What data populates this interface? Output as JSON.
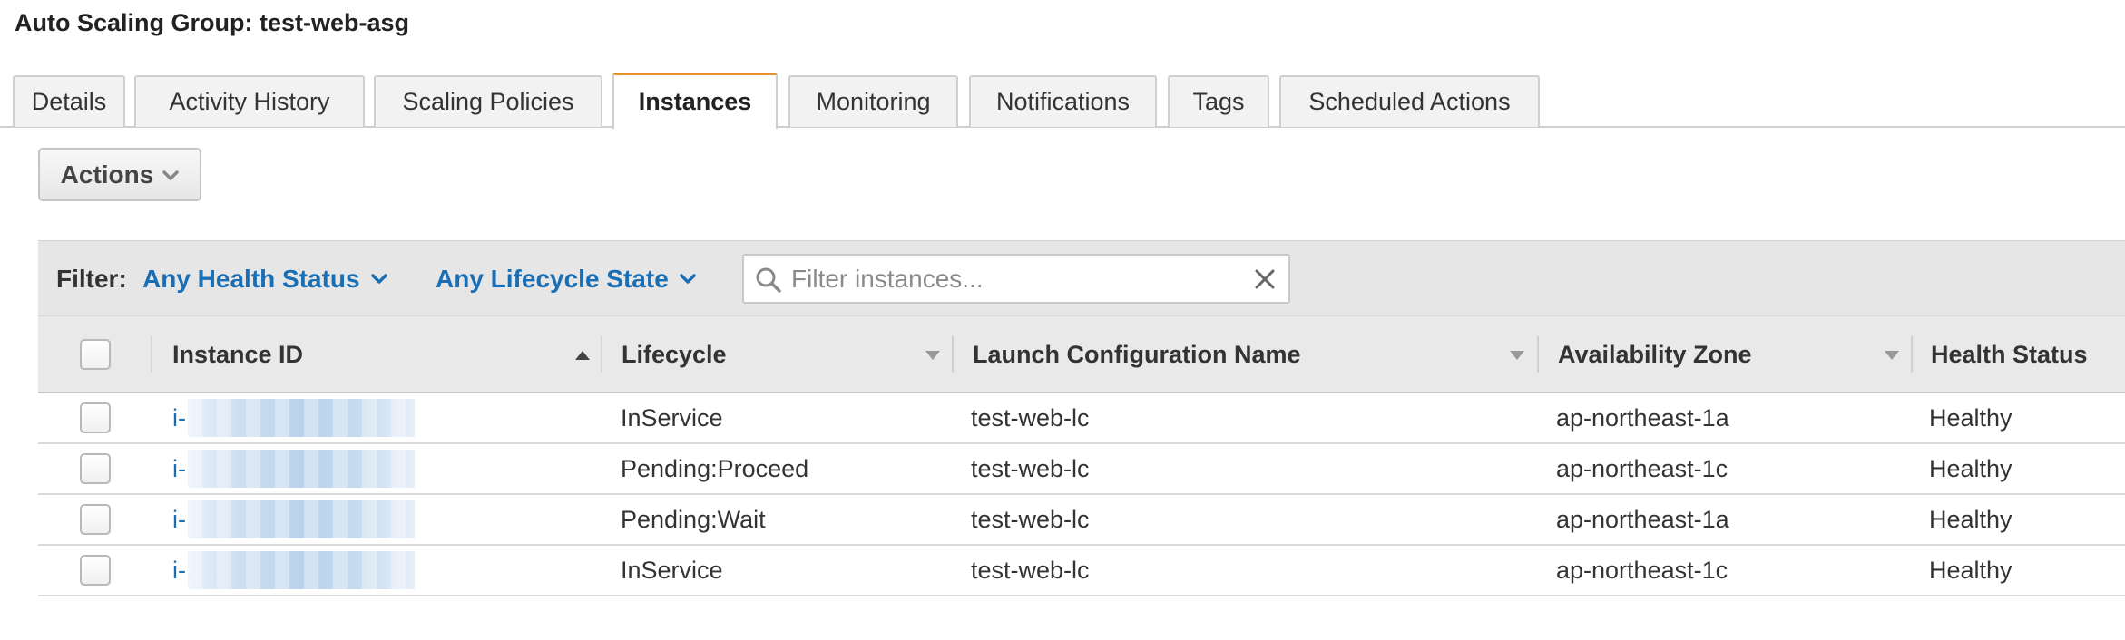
{
  "page": {
    "title": "Auto Scaling Group: test-web-asg"
  },
  "tabs": [
    {
      "label": "Details"
    },
    {
      "label": "Activity History"
    },
    {
      "label": "Scaling Policies"
    },
    {
      "label": "Instances",
      "active": true
    },
    {
      "label": "Monitoring"
    },
    {
      "label": "Notifications"
    },
    {
      "label": "Tags"
    },
    {
      "label": "Scheduled Actions"
    }
  ],
  "toolbar": {
    "actions_label": "Actions"
  },
  "filter": {
    "label": "Filter:",
    "health_status": "Any Health Status",
    "lifecycle_state": "Any Lifecycle State",
    "search_placeholder": "Filter instances...",
    "search_value": ""
  },
  "table": {
    "columns": [
      {
        "label": "Instance ID",
        "sort": "ascending"
      },
      {
        "label": "Lifecycle"
      },
      {
        "label": "Launch Configuration Name"
      },
      {
        "label": "Availability Zone"
      },
      {
        "label": "Health Status"
      }
    ],
    "rows": [
      {
        "instance_id": "i-",
        "lifecycle": "InService",
        "launch_config": "test-web-lc",
        "az": "ap-northeast-1a",
        "health": "Healthy"
      },
      {
        "instance_id": "i-",
        "lifecycle": "Pending:Proceed",
        "launch_config": "test-web-lc",
        "az": "ap-northeast-1c",
        "health": "Healthy"
      },
      {
        "instance_id": "i-",
        "lifecycle": "Pending:Wait",
        "launch_config": "test-web-lc",
        "az": "ap-northeast-1a",
        "health": "Healthy"
      },
      {
        "instance_id": "i-",
        "lifecycle": "InService",
        "launch_config": "test-web-lc",
        "az": "ap-northeast-1c",
        "health": "Healthy"
      }
    ]
  },
  "colors": {
    "link": "#1a6eb4",
    "active_tab_accent": "#e7912a",
    "header_bg": "#e9e9e9"
  },
  "icons": [
    "chevron-down-icon",
    "search-icon",
    "clear-icon",
    "sort-asc-icon",
    "sort-desc-icon"
  ]
}
